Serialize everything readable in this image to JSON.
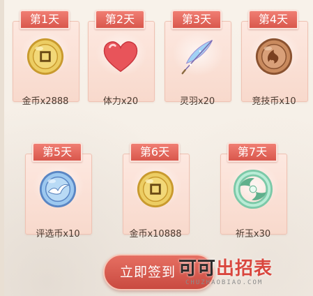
{
  "rewards": [
    {
      "day": "第1天",
      "item": "金币x2888",
      "icon": "gold-coin-icon"
    },
    {
      "day": "第2天",
      "item": "体力x20",
      "icon": "heart-icon"
    },
    {
      "day": "第3天",
      "item": "灵羽x20",
      "icon": "feather-icon"
    },
    {
      "day": "第4天",
      "item": "竞技币x10",
      "icon": "arena-coin-icon"
    },
    {
      "day": "第5天",
      "item": "评选币x10",
      "icon": "vote-coin-icon"
    },
    {
      "day": "第6天",
      "item": "金币x10888",
      "icon": "gold-coin-icon"
    },
    {
      "day": "第7天",
      "item": "祈玉x30",
      "icon": "jade-icon"
    }
  ],
  "checkin_button": "立即签到",
  "watermark": {
    "main_dark": "可可",
    "main_red": "出招表",
    "sub": "CHUZHAOBIAO.COM"
  },
  "colors": {
    "tab_red": "#d9574c",
    "card_pink": "#fde8e0",
    "gold": "#e8c25a",
    "jade": "#a8e0c8",
    "blue_coin": "#8ec3ee",
    "bronze": "#c98a5e"
  }
}
